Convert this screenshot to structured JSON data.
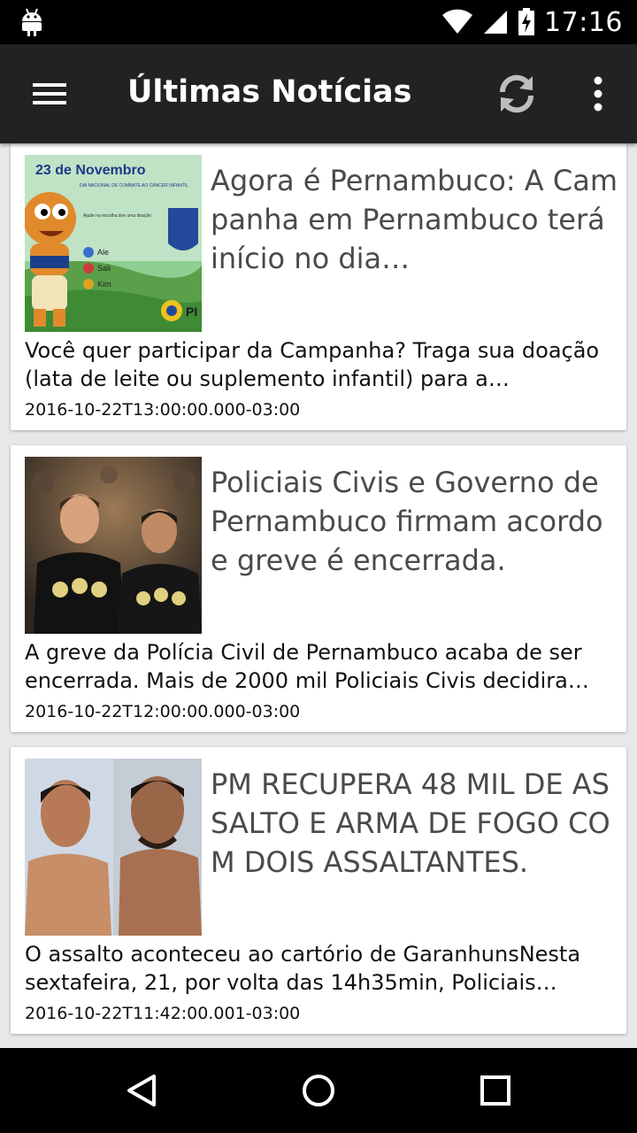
{
  "status_bar": {
    "time": "17:16",
    "icons": [
      "android-icon",
      "wifi-icon",
      "signal-icon",
      "battery-charging-icon"
    ]
  },
  "app_bar": {
    "title": "Últimas Notícias",
    "icons": [
      "menu-icon",
      "refresh-icon",
      "overflow-menu-icon"
    ]
  },
  "articles": [
    {
      "headline": "Agora é Pernambuco: A Campanha em Pernambuco terá início no dia…",
      "summary": "Você quer participar da Campanha?   Traga sua doação (lata de leite ou suplemento infantil) para a…",
      "timestamp": "2016-10-22T13:00:00.000-03:00",
      "thumb_text": {
        "date": "23 de Novembro",
        "caption": "DIA NACIONAL DE COMBATE AO CÂNCER INFANTIL",
        "sub": "Ajude na escolha doe uma doação",
        "opt1": "Ale",
        "opt2": "Sali",
        "opt3": "Kim",
        "badge": "PI"
      }
    },
    {
      "headline": "Policiais Civis e Governo de Pernambuco firmam acordo e greve é encerrada.",
      "summary": "A greve da Polícia Civil de Pernambuco acaba de ser encerrada. Mais de 2000 mil Policiais Civis decidira…",
      "timestamp": "2016-10-22T12:00:00.000-03:00"
    },
    {
      "headline": "PM RECUPERA 48 MIL DE ASSALTO E ARMA DE FOGO COM DOIS ASSALTANTES.",
      "summary": "O assalto aconteceu ao cartório de GaranhunsNesta sextafeira, 21, por volta das 14h35min, Policiais…",
      "timestamp": "2016-10-22T11:42:00.001-03:00"
    }
  ],
  "nav_bar": {
    "icons": [
      "back-icon",
      "home-icon",
      "recents-icon"
    ]
  },
  "colors": {
    "app_bar": "#222222",
    "background": "#e8e8e8",
    "card": "#ffffff",
    "headline_text": "#4a4a4a"
  }
}
